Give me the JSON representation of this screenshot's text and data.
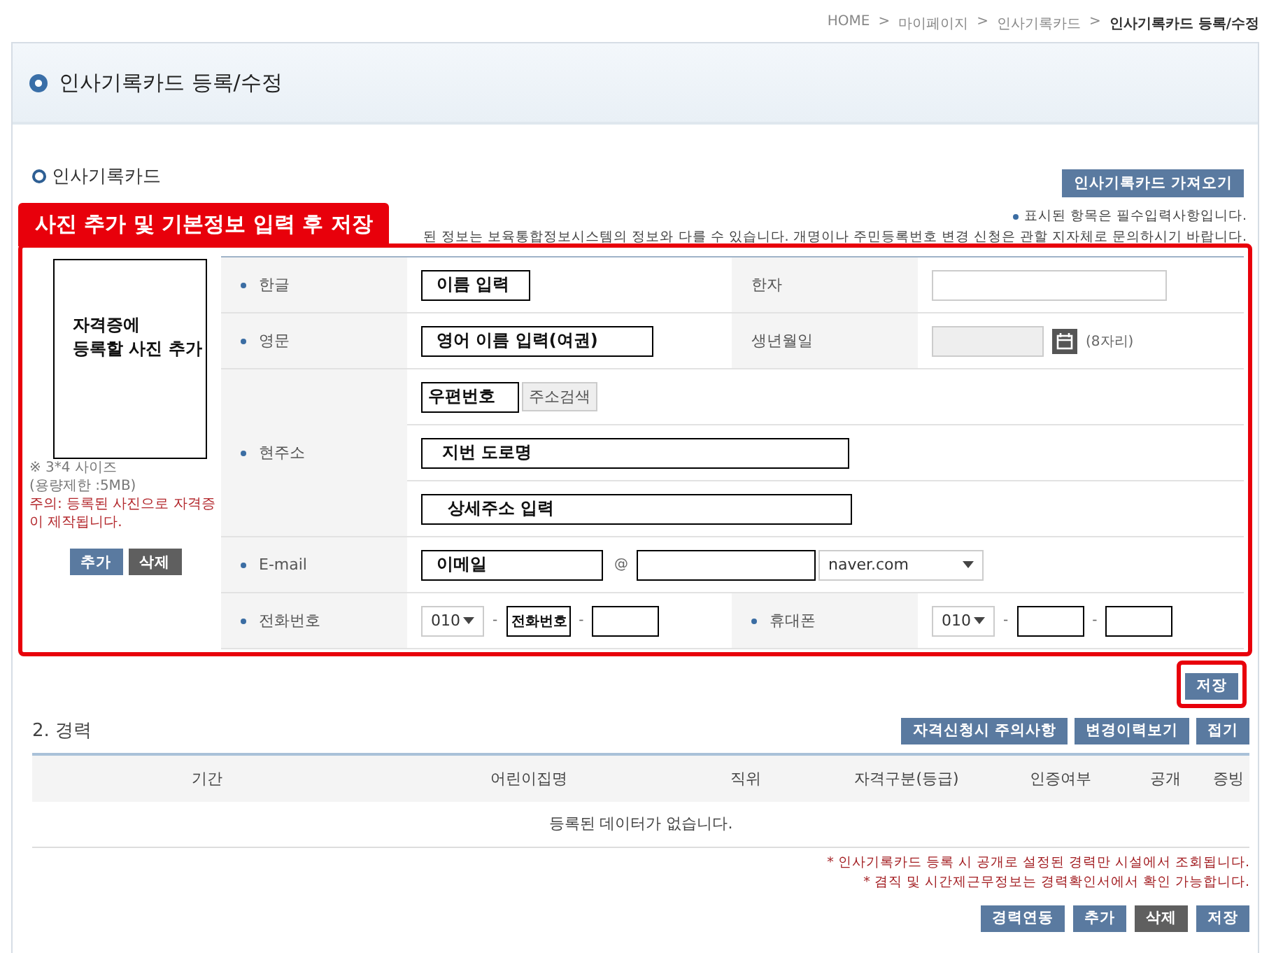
{
  "breadcrumb": [
    {
      "label": "HOME",
      "current": false
    },
    {
      "label": "마이페이지",
      "current": false
    },
    {
      "label": "인사기록카드",
      "current": false
    },
    {
      "label": "인사기록카드 등록/수정",
      "current": true
    }
  ],
  "breadcrumb_separator": ">",
  "page_title": "인사기록카드 등록/수정",
  "section_title": "인사기록카드",
  "import_button": "인사기록카드 가져오기",
  "banner": "사진 추가 및 기본정보 입력 후 저장",
  "required_note": "표시된 항목은 필수입력사항입니다.",
  "notice": "된 정보는 보육통합정보시스템의 정보와 다를 수 있습니다. 개명이나 주민등록번호 변경 신청은 관할 지자체로 문의하시기 바랍니다.",
  "photo": {
    "lines": [
      "자격증에",
      "등록할 사진 추가"
    ],
    "size_note": [
      "※ 3*4 사이즈",
      "(용량제한 :5MB)"
    ],
    "warning": "주의: 등록된 사진으로 자격증이 제작됩니다.",
    "buttons": [
      {
        "label": "추가",
        "kind": "primary"
      },
      {
        "label": "삭제",
        "kind": "dark"
      }
    ]
  },
  "form": {
    "name_kor": {
      "label": "한글",
      "required": true,
      "value": "이름 입력"
    },
    "hanja": {
      "label": "한자",
      "required": false
    },
    "name_eng": {
      "label": "영문",
      "required": true,
      "value": "영어 이름 입력(여권)"
    },
    "birth": {
      "label": "생년월일",
      "required": false,
      "hint": "(8자리)"
    },
    "address": {
      "label": "현주소",
      "required": true,
      "zip": "우편번호",
      "search_button": "주소검색",
      "line1": "지번 도로명",
      "line2": "상세주소 입력"
    },
    "email": {
      "label": "E-mail",
      "required": true,
      "id_value": "이메일",
      "at": "@",
      "domain": "naver.com"
    },
    "phone": {
      "label": "전화번호",
      "required": true,
      "prefix": "010",
      "middle": "전화번호",
      "separators": [
        "-",
        "-"
      ]
    },
    "mobile": {
      "label": "휴대폰",
      "required": true,
      "prefix": "010",
      "separators": [
        "-",
        "-"
      ]
    }
  },
  "save_button": {
    "label": "저장",
    "highlighted": true
  },
  "career": {
    "title": "2. 경력",
    "buttons": [
      {
        "label": "자격신청시 주의사항"
      },
      {
        "label": "변경이력보기"
      },
      {
        "label": "접기"
      }
    ],
    "columns": [
      "기간",
      "어린이집명",
      "직위",
      "자격구분(등급)",
      "인증여부",
      "공개",
      "증빙"
    ],
    "empty": "등록된 데이터가 없습니다.",
    "notes": [
      "* 인사기록카드 등록 시 공개로 설정된 경력만 시설에서 조회됩니다.",
      "* 겸직 및 시간제근무정보는 경력확인서에서 확인 가능합니다."
    ],
    "actions": [
      {
        "label": "경력연동",
        "kind": "primary"
      },
      {
        "label": "추가",
        "kind": "primary"
      },
      {
        "label": "삭제",
        "kind": "dark"
      },
      {
        "label": "저장",
        "kind": "primary"
      }
    ]
  }
}
